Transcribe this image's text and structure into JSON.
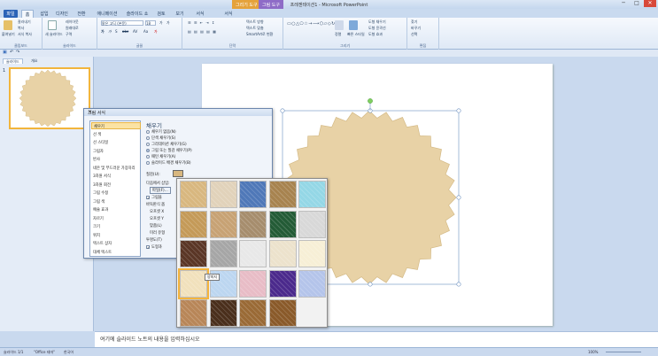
{
  "app": {
    "title": "프레젠테이션1 - Microsoft PowerPoint",
    "context_tabs": [
      "그리기 도구",
      "그림 도구"
    ],
    "window_buttons": [
      "─",
      "□",
      "✕"
    ]
  },
  "tabs": [
    "파일",
    "홈",
    "삽입",
    "디자인",
    "전환",
    "애니메이션",
    "슬라이드 쇼",
    "검토",
    "보기",
    "서식",
    "서식"
  ],
  "ribbon": {
    "groups": [
      {
        "name": "클립보드",
        "items": [
          "붙여넣기",
          "잘라내기",
          "복사",
          "서식 복사"
        ]
      },
      {
        "name": "슬라이드",
        "items": [
          "새 슬라이드",
          "레이아웃",
          "원래대로",
          "구역"
        ]
      },
      {
        "name": "글꼴",
        "items": [
          "맑은 고딕 (본문)",
          "18",
          "가",
          "가",
          "가",
          "가",
          "S",
          "abc",
          "AV",
          "Aa",
          "가"
        ]
      },
      {
        "name": "단락",
        "items": [
          "텍스트 방향",
          "텍스트 맞춤",
          "SmartArt로 변환"
        ]
      },
      {
        "name": "그리기",
        "items": [
          "정렬",
          "빠른 스타일",
          "도형 채우기",
          "도형 윤곽선",
          "도형 효과"
        ]
      },
      {
        "name": "편집",
        "items": [
          "찾기",
          "바꾸기",
          "선택"
        ]
      }
    ]
  },
  "left_pane": {
    "tabs": [
      "슬라이드",
      "개요"
    ],
    "slide_number": "1"
  },
  "notes": {
    "placeholder": "여기에 슬라이드 노트의 내용을 입력하십시오"
  },
  "status": {
    "slide": "슬라이드 1/1",
    "theme": "\"Office 테마\"",
    "language": "한국어",
    "zoom": "100%"
  },
  "dialog": {
    "title": "그림 서식",
    "categories": [
      "채우기",
      "선 색",
      "선 스타일",
      "그림자",
      "반사",
      "네온 및 부드러운 가장자리",
      "3차원 서식",
      "3차원 회전",
      "그림 수정",
      "그림 색",
      "예술 효과",
      "자르기",
      "크기",
      "위치",
      "텍스트 상자",
      "대체 텍스트"
    ],
    "selected_category": "채우기",
    "section_title": "채우기",
    "fill_options": [
      "채우기 없음(N)",
      "단색 채우기(S)",
      "그라데이션 채우기(G)",
      "그림 또는 질감 채우기(P)",
      "패턴 채우기(A)",
      "슬라이드 배경 채우기(B)"
    ],
    "selected_fill": "그림 또는 질감 채우기(P)",
    "texture_label": "질감(U):",
    "insert_from": "다음에서 삽입:",
    "file_button": "파일(F)...",
    "tile_check": "그림을",
    "partial_labels": [
      "바둑판식 옵",
      "오프셋 X",
      "오프셋 Y",
      "맞춤(L)",
      "미러 유형"
    ],
    "transparency": "투명도(T)",
    "rotate_check": "도형과"
  },
  "texture_picker": {
    "tooltip": "양피지",
    "textures": [
      {
        "name": "papyrus",
        "color": "#d8b77f"
      },
      {
        "name": "canvas",
        "color": "#e1d2ba"
      },
      {
        "name": "denim",
        "color": "#4f78b8"
      },
      {
        "name": "woven-mat",
        "color": "#a7834f"
      },
      {
        "name": "water-droplets",
        "color": "#94d7e6"
      },
      {
        "name": "paper-bag",
        "color": "#c49a58"
      },
      {
        "name": "fish-fossil",
        "color": "#c7a274"
      },
      {
        "name": "sand",
        "color": "#a68d6d"
      },
      {
        "name": "green-marble",
        "color": "#235b36"
      },
      {
        "name": "white-marble",
        "color": "#d8d8d8"
      },
      {
        "name": "brown-marble",
        "color": "#5a3626"
      },
      {
        "name": "granite",
        "color": "#a6a6a6"
      },
      {
        "name": "newsprint",
        "color": "#e8e8e8"
      },
      {
        "name": "recycled-paper",
        "color": "#ece2cc"
      },
      {
        "name": "stationery",
        "color": "#f7efd6"
      },
      {
        "name": "parchment",
        "color": "#f1e1bc"
      },
      {
        "name": "blue-tissue-paper",
        "color": "#bcd6f0"
      },
      {
        "name": "pink-tissue-paper",
        "color": "#e8bcc6"
      },
      {
        "name": "purple-mesh",
        "color": "#4b2a8c"
      },
      {
        "name": "bouquet",
        "color": "#b4c4ea"
      },
      {
        "name": "cork",
        "color": "#b88658"
      },
      {
        "name": "walnut",
        "color": "#4a2f1c"
      },
      {
        "name": "oak",
        "color": "#9a6a36"
      },
      {
        "name": "medium-wood",
        "color": "#8a5a2a"
      }
    ],
    "hover_index": 15
  },
  "shape": {
    "fill": "#e8d2a6",
    "selection": "#6b8fbf",
    "rotate_handle": "#7fcf5f"
  }
}
